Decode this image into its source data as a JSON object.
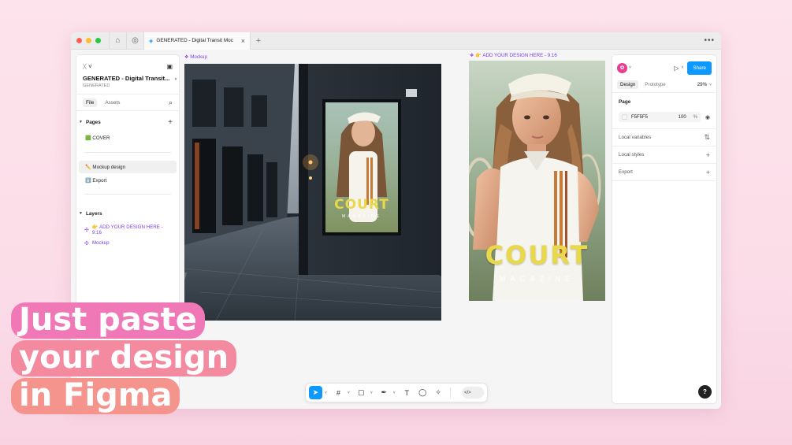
{
  "titlebar": {
    "tab_title": "GENERATED - Digital Transit Moc",
    "colors": {
      "close": "#ff5f57",
      "minimize": "#febc2e",
      "maximize": "#28c840"
    }
  },
  "left_panel": {
    "file_title": "GENERATED - Digital Transit...",
    "file_subtitle": "GENERATED",
    "tabs": [
      "File",
      "Assets"
    ],
    "pages_label": "Pages",
    "pages": [
      {
        "label": "🟩 COVER"
      },
      {
        "label": "✏️ Mockup design"
      },
      {
        "label": "⬇️ Export"
      }
    ],
    "layers_label": "Layers",
    "layers": [
      {
        "label": "👉 ADD YOUR DESIGN HERE - 9:16"
      },
      {
        "label": "Mockup"
      }
    ]
  },
  "canvas": {
    "frame1_label": "❖ Mockup",
    "frame2_label": "❖ 👉 ADD YOUR DESIGN HERE - 9:16",
    "poster_title": "COURT",
    "poster_subtitle": "MAGAZINE",
    "colors": {
      "poster_text": "#e9d84a",
      "frame_label": "#7b3fe4"
    }
  },
  "right_panel": {
    "share_label": "Share",
    "tabs": [
      "Design",
      "Prototype"
    ],
    "zoom": "29%",
    "page_label": "Page",
    "page_color": "F5F5F5",
    "opacity": "100",
    "opacity_unit": "%",
    "rows": [
      "Local variables",
      "Local styles",
      "Export"
    ],
    "colors": {
      "share": "#0d99ff",
      "avatar": "#e73f8f"
    }
  },
  "help_label": "?",
  "headline": {
    "lines": [
      "Just paste",
      "your design",
      "in Figma"
    ],
    "colors": [
      "#f178b6",
      "#f48a9f",
      "#f5948d"
    ]
  }
}
